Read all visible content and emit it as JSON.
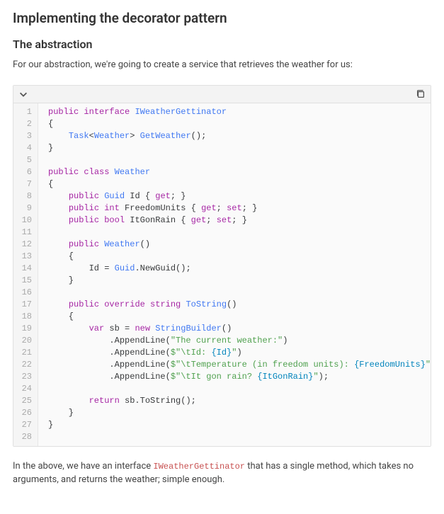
{
  "heading": "Implementing the decorator pattern",
  "subheading": "The abstraction",
  "intro": "For our abstraction, we're going to create a service that retrieves the weather for us:",
  "code": {
    "lines": [
      [
        {
          "t": "public",
          "c": "kw"
        },
        {
          "t": " ",
          "c": "pl"
        },
        {
          "t": "interface",
          "c": "kw"
        },
        {
          "t": " ",
          "c": "pl"
        },
        {
          "t": "IWeatherGettinator",
          "c": "typ"
        }
      ],
      [
        {
          "t": "{",
          "c": "pl"
        }
      ],
      [
        {
          "t": "    ",
          "c": "pl"
        },
        {
          "t": "Task",
          "c": "typ"
        },
        {
          "t": "<",
          "c": "pl"
        },
        {
          "t": "Weather",
          "c": "typ"
        },
        {
          "t": "> ",
          "c": "pl"
        },
        {
          "t": "GetWeather",
          "c": "typ"
        },
        {
          "t": "();",
          "c": "pl"
        }
      ],
      [
        {
          "t": "}",
          "c": "pl"
        }
      ],
      [],
      [
        {
          "t": "public",
          "c": "kw"
        },
        {
          "t": " ",
          "c": "pl"
        },
        {
          "t": "class",
          "c": "kw"
        },
        {
          "t": " ",
          "c": "pl"
        },
        {
          "t": "Weather",
          "c": "typ"
        }
      ],
      [
        {
          "t": "{",
          "c": "pl"
        }
      ],
      [
        {
          "t": "    ",
          "c": "pl"
        },
        {
          "t": "public",
          "c": "kw"
        },
        {
          "t": " ",
          "c": "pl"
        },
        {
          "t": "Guid",
          "c": "typ"
        },
        {
          "t": " Id { ",
          "c": "pl"
        },
        {
          "t": "get",
          "c": "kw"
        },
        {
          "t": "; }",
          "c": "pl"
        }
      ],
      [
        {
          "t": "    ",
          "c": "pl"
        },
        {
          "t": "public",
          "c": "kw"
        },
        {
          "t": " ",
          "c": "pl"
        },
        {
          "t": "int",
          "c": "kw"
        },
        {
          "t": " FreedomUnits { ",
          "c": "pl"
        },
        {
          "t": "get",
          "c": "kw"
        },
        {
          "t": "; ",
          "c": "pl"
        },
        {
          "t": "set",
          "c": "kw"
        },
        {
          "t": "; }",
          "c": "pl"
        }
      ],
      [
        {
          "t": "    ",
          "c": "pl"
        },
        {
          "t": "public",
          "c": "kw"
        },
        {
          "t": " ",
          "c": "pl"
        },
        {
          "t": "bool",
          "c": "kw"
        },
        {
          "t": " ItGonRain { ",
          "c": "pl"
        },
        {
          "t": "get",
          "c": "kw"
        },
        {
          "t": "; ",
          "c": "pl"
        },
        {
          "t": "set",
          "c": "kw"
        },
        {
          "t": "; }",
          "c": "pl"
        }
      ],
      [],
      [
        {
          "t": "    ",
          "c": "pl"
        },
        {
          "t": "public",
          "c": "kw"
        },
        {
          "t": " ",
          "c": "pl"
        },
        {
          "t": "Weather",
          "c": "typ"
        },
        {
          "t": "()",
          "c": "pl"
        }
      ],
      [
        {
          "t": "    {",
          "c": "pl"
        }
      ],
      [
        {
          "t": "        Id = ",
          "c": "pl"
        },
        {
          "t": "Guid",
          "c": "typ"
        },
        {
          "t": ".NewGuid();",
          "c": "pl"
        }
      ],
      [
        {
          "t": "    }",
          "c": "pl"
        }
      ],
      [],
      [
        {
          "t": "    ",
          "c": "pl"
        },
        {
          "t": "public",
          "c": "kw"
        },
        {
          "t": " ",
          "c": "pl"
        },
        {
          "t": "override",
          "c": "kw"
        },
        {
          "t": " ",
          "c": "pl"
        },
        {
          "t": "string",
          "c": "kw"
        },
        {
          "t": " ",
          "c": "pl"
        },
        {
          "t": "ToString",
          "c": "typ"
        },
        {
          "t": "()",
          "c": "pl"
        }
      ],
      [
        {
          "t": "    {",
          "c": "pl"
        }
      ],
      [
        {
          "t": "        ",
          "c": "pl"
        },
        {
          "t": "var",
          "c": "kw"
        },
        {
          "t": " sb = ",
          "c": "pl"
        },
        {
          "t": "new",
          "c": "kw"
        },
        {
          "t": " ",
          "c": "pl"
        },
        {
          "t": "StringBuilder",
          "c": "typ"
        },
        {
          "t": "()",
          "c": "pl"
        }
      ],
      [
        {
          "t": "            .AppendLine(",
          "c": "pl"
        },
        {
          "t": "\"The current weather:\"",
          "c": "str"
        },
        {
          "t": ")",
          "c": "pl"
        }
      ],
      [
        {
          "t": "            .AppendLine(",
          "c": "pl"
        },
        {
          "t": "$\"\\tId: ",
          "c": "str"
        },
        {
          "t": "{Id}",
          "c": "iv"
        },
        {
          "t": "\"",
          "c": "str"
        },
        {
          "t": ")",
          "c": "pl"
        }
      ],
      [
        {
          "t": "            .AppendLine(",
          "c": "pl"
        },
        {
          "t": "$\"\\tTemperature (in freedom units): ",
          "c": "str"
        },
        {
          "t": "{FreedomUnits}",
          "c": "iv"
        },
        {
          "t": "\"",
          "c": "str"
        },
        {
          "t": ")",
          "c": "pl"
        }
      ],
      [
        {
          "t": "            .AppendLine(",
          "c": "pl"
        },
        {
          "t": "$\"\\tIt gon rain? ",
          "c": "str"
        },
        {
          "t": "{ItGonRain}",
          "c": "iv"
        },
        {
          "t": "\"",
          "c": "str"
        },
        {
          "t": ");",
          "c": "pl"
        }
      ],
      [],
      [
        {
          "t": "        ",
          "c": "pl"
        },
        {
          "t": "return",
          "c": "kw"
        },
        {
          "t": " sb.ToString();",
          "c": "pl"
        }
      ],
      [
        {
          "t": "    }",
          "c": "pl"
        }
      ],
      [
        {
          "t": "}",
          "c": "pl"
        }
      ],
      []
    ]
  },
  "outro_pre": "In the above, we have an interface ",
  "outro_code": "IWeatherGettinator",
  "outro_post": " that has a single method, which takes no arguments, and returns the weather; simple enough."
}
